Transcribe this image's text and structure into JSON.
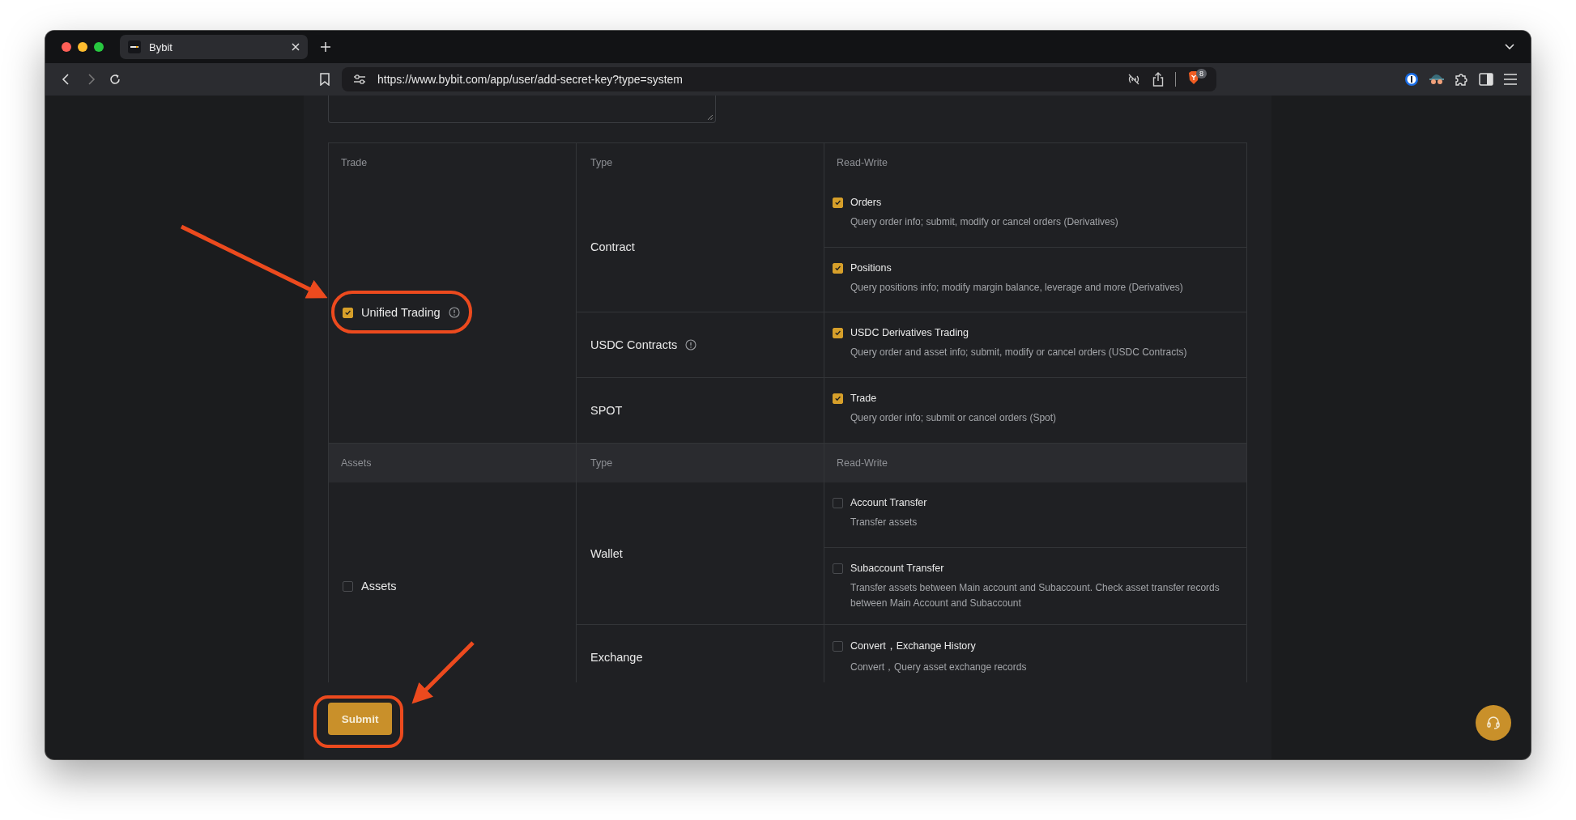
{
  "browser": {
    "tab": {
      "title": "Bybit",
      "selected": true
    },
    "url": "https://www.bybit.com/app/user/add-secret-key?type=system",
    "shield_badge": "8"
  },
  "sections": [
    {
      "shaded": false,
      "headers": {
        "group": "Trade",
        "type": "Type",
        "access": "Read-Write"
      },
      "group": {
        "label": "Unified Trading",
        "checked": true,
        "info": true
      },
      "types": [
        {
          "name": "Contract",
          "info": false,
          "permissions": [
            {
              "title": "Orders",
              "description": "Query order info; submit, modify or cancel orders (Derivatives)",
              "checked": true
            },
            {
              "title": "Positions",
              "description": "Query positions info; modify margin balance, leverage and more (Derivatives)",
              "checked": true
            }
          ]
        },
        {
          "name": "USDC Contracts",
          "info": true,
          "permissions": [
            {
              "title": "USDC Derivatives Trading",
              "description": "Query order and asset info; submit, modify or cancel orders (USDC Contracts)",
              "checked": true
            }
          ]
        },
        {
          "name": "SPOT",
          "info": false,
          "permissions": [
            {
              "title": "Trade",
              "description": "Query order info; submit or cancel orders (Spot)",
              "checked": true
            }
          ]
        }
      ]
    },
    {
      "shaded": true,
      "headers": {
        "group": "Assets",
        "type": "Type",
        "access": "Read-Write"
      },
      "group": {
        "label": "Assets",
        "checked": false,
        "info": false
      },
      "types": [
        {
          "name": "Wallet",
          "info": false,
          "permissions": [
            {
              "title": "Account Transfer",
              "description": "Transfer assets",
              "checked": false
            },
            {
              "title": "Subaccount Transfer",
              "description": "Transfer assets between Main account and Subaccount. Check asset transfer records between Main Account and Subaccount",
              "checked": false
            }
          ]
        },
        {
          "name": "Exchange",
          "info": false,
          "permissions": [
            {
              "title": "Convert，Exchange History",
              "description": "Convert，Query asset exchange records",
              "checked": false
            }
          ]
        }
      ]
    }
  ],
  "submit": {
    "label": "Submit"
  }
}
